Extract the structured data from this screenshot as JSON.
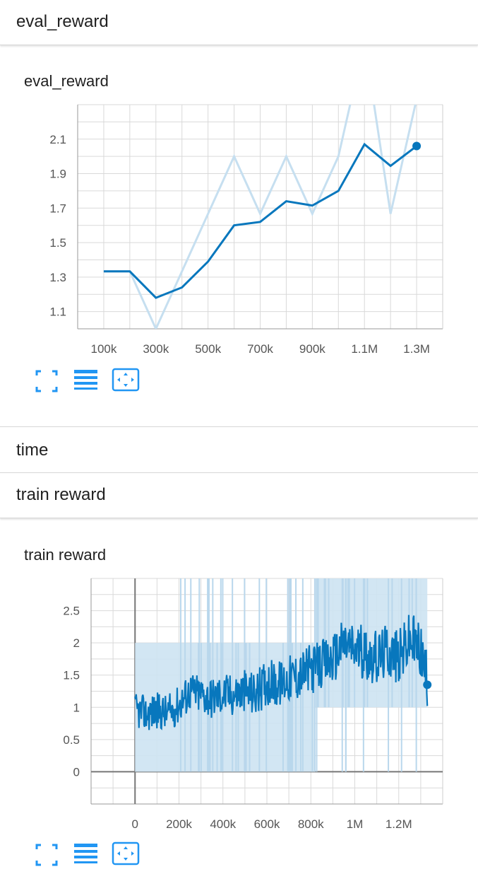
{
  "sections": {
    "eval_header": "eval_reward",
    "time_header": "time",
    "train_header": "train reward"
  },
  "cards": {
    "eval_title": "eval_reward",
    "train_title": "train reward"
  },
  "icons": {
    "expand": "fit-to-screen-icon",
    "data_toggle": "data-table-icon",
    "fit_domain": "fit-domain-icon"
  },
  "colors": {
    "smoothed_line": "#0877bd",
    "raw_line": "#c6dff0",
    "band": "#cde3f2",
    "grid": "#cccccc",
    "icon": "#2196f3"
  },
  "chart_data": [
    {
      "type": "line",
      "title": "eval_reward",
      "xlabel": "",
      "ylabel": "",
      "x_ticks": [
        "100k",
        "300k",
        "500k",
        "700k",
        "900k",
        "1.1M",
        "1.3M"
      ],
      "x_tick_values": [
        100000,
        300000,
        500000,
        700000,
        900000,
        1100000,
        1300000
      ],
      "y_ticks": [
        "1.1",
        "1.3",
        "1.5",
        "1.7",
        "1.9",
        "2.1"
      ],
      "y_tick_values": [
        1.1,
        1.3,
        1.5,
        1.7,
        1.9,
        2.1
      ],
      "xlim": [
        0,
        1400000
      ],
      "ylim": [
        1.0,
        2.3
      ],
      "grid": true,
      "series": [
        {
          "role": "raw",
          "x": [
            100000,
            200000,
            300000,
            400000,
            500000,
            600000,
            700000,
            800000,
            900000,
            1000000,
            1100000,
            1200000,
            1300000
          ],
          "y": [
            1.333,
            1.333,
            1.0,
            1.333,
            1.667,
            2.0,
            1.667,
            2.0,
            1.667,
            2.0,
            2.667,
            1.667,
            2.333
          ]
        },
        {
          "role": "smoothed",
          "x": [
            100000,
            200000,
            300000,
            400000,
            500000,
            600000,
            700000,
            800000,
            900000,
            1000000,
            1100000,
            1200000,
            1300000
          ],
          "y": [
            1.333,
            1.333,
            1.18,
            1.24,
            1.39,
            1.6,
            1.62,
            1.74,
            1.715,
            1.8,
            2.07,
            1.945,
            2.06
          ]
        }
      ]
    },
    {
      "type": "line",
      "title": "train reward",
      "xlabel": "",
      "ylabel": "",
      "x_ticks": [
        "0",
        "200k",
        "400k",
        "600k",
        "800k",
        "1M",
        "1.2M"
      ],
      "x_tick_values": [
        0,
        200000,
        400000,
        600000,
        800000,
        1000000,
        1200000
      ],
      "y_ticks": [
        "0",
        "0.5",
        "1",
        "1.5",
        "2",
        "2.5"
      ],
      "y_tick_values": [
        0,
        0.5,
        1,
        1.5,
        2,
        2.5
      ],
      "xlim": [
        -200000,
        1400000
      ],
      "ylim": [
        -0.5,
        3.0
      ],
      "grid": true,
      "band": {
        "segments": [
          {
            "x": [
              0,
              200000
            ],
            "low": 0,
            "high": 2
          },
          {
            "x": [
              200000,
              820000
            ],
            "low": 0,
            "high": 2
          },
          {
            "x": [
              820000,
              1330000
            ],
            "low": 1,
            "high": 3
          }
        ]
      },
      "series": [
        {
          "role": "smoothed",
          "x": [
            0,
            50000,
            100000,
            150000,
            200000,
            250000,
            300000,
            350000,
            400000,
            450000,
            500000,
            550000,
            600000,
            650000,
            700000,
            750000,
            800000,
            850000,
            900000,
            950000,
            1000000,
            1050000,
            1100000,
            1150000,
            1200000,
            1250000,
            1300000,
            1330000
          ],
          "y": [
            0.95,
            0.9,
            0.95,
            0.9,
            1.05,
            1.25,
            1.2,
            1.15,
            1.2,
            1.2,
            1.25,
            1.2,
            1.4,
            1.35,
            1.45,
            1.5,
            1.6,
            1.65,
            1.75,
            2.0,
            1.9,
            1.85,
            1.75,
            1.9,
            1.75,
            2.05,
            1.9,
            1.35
          ]
        }
      ]
    }
  ]
}
